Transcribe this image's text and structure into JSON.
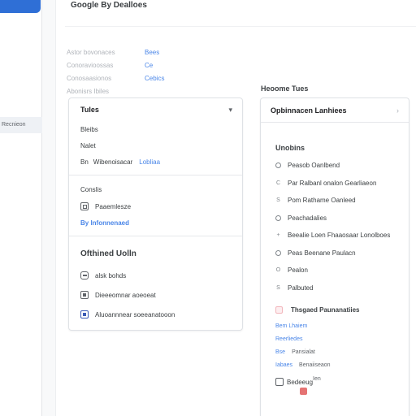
{
  "header": {
    "title": "Google By Dealloes"
  },
  "sidebar": {
    "selected_item": "Recnieon"
  },
  "meta": [
    {
      "key": "Astor bovonaces",
      "value": "Bees"
    },
    {
      "key": "Conoravioossas",
      "value": "Ce"
    },
    {
      "key": "Conosaasionos",
      "value": "Cebics"
    },
    {
      "key": "Abonisrs  Ibiles",
      "value": ""
    }
  ],
  "left_card": {
    "header": "Tules",
    "rows": [
      "Bleibs",
      "Nalet"
    ],
    "row3_prefix": "Bn",
    "row3_text": "Wibenoisacar",
    "row3_link": "Lobliaa",
    "section2_title": "Conslis",
    "section2_item": "Paaemlesze",
    "section2_link": "By lnfonnenaed",
    "section3_title": "Ofthined Uolln",
    "section3_items": [
      "alsk bohds",
      "Dieeeomnar aoeoeat",
      "Aluoannnear soeeanatooon"
    ]
  },
  "right_panel": {
    "label": "Heoome Tues",
    "header": "Opbinnacen Lanhiees",
    "section_title": "Unobins",
    "options": [
      {
        "glyph": "radio",
        "text": "Peasob Oanlbend"
      },
      {
        "glyph": "C",
        "text": "Par Ralbanl onalon Gearliaeon"
      },
      {
        "glyph": "S",
        "text": "Pom Rathame Oanleed"
      },
      {
        "glyph": "radio",
        "text": "Peachadalies"
      },
      {
        "glyph": "+",
        "text": "Beealie Loen Fhaaosaar Lonolboes"
      },
      {
        "glyph": "radio",
        "text": "Peas Beenane Paulacn"
      },
      {
        "glyph": "O",
        "text": "Pealon"
      },
      {
        "glyph": "S",
        "text": "Palbuted"
      }
    ],
    "checkbox_label": "Thsgaed Paunanatiies",
    "links": [
      {
        "blue": "Bem Lhaiem",
        "gray": ""
      },
      {
        "blue": "Reerliedes",
        "gray": ""
      },
      {
        "blue": "Bse",
        "gray": "Pansialat"
      },
      {
        "blue": "Iabaes",
        "gray": "Benaiiseaon"
      }
    ],
    "footer_text": "Bedeeug",
    "footer_right": "Ien"
  }
}
